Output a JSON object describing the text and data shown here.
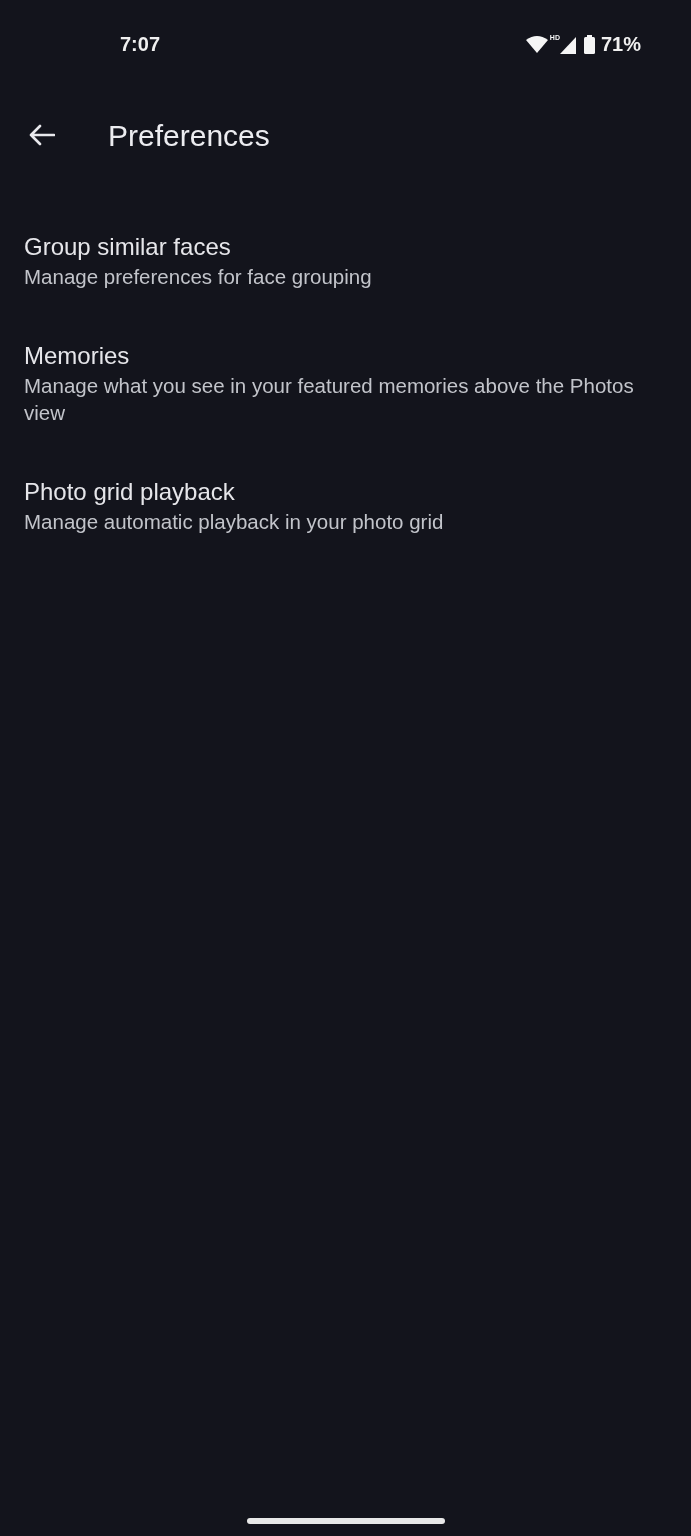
{
  "status_bar": {
    "time": "7:07",
    "network_badge": "HD",
    "battery": "71%"
  },
  "app_bar": {
    "title": "Preferences"
  },
  "items": [
    {
      "title": "Group similar faces",
      "subtitle": "Manage preferences for face grouping"
    },
    {
      "title": "Memories",
      "subtitle": "Manage what you see in your featured memories above the Photos view"
    },
    {
      "title": "Photo grid playback",
      "subtitle": "Manage automatic playback in your photo grid"
    }
  ]
}
